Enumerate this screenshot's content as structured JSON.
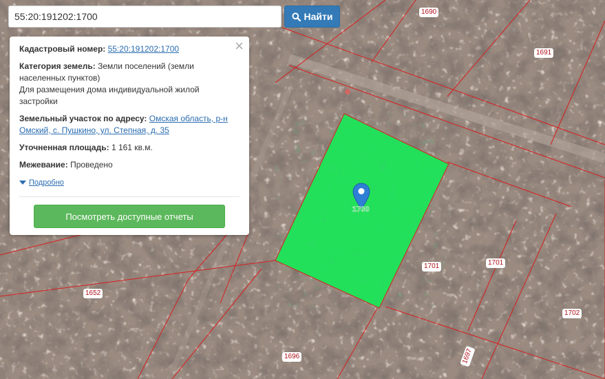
{
  "search": {
    "value": "55:20:191202:1700",
    "button_label": "Найти"
  },
  "info_panel": {
    "cadastral_label": "Кадастровый номер:",
    "cadastral_number": "55:20:191202:1700",
    "category_label": "Категория земель:",
    "category_value": "Земли поселений (земли населенных пунктов)",
    "usage": "Для размещения дома индивидуальной жилой застройки",
    "address_label": "Земельный участок по адресу:",
    "address_value": "Омская область, р-н Омский, с. Пушкино, ул. Степная, д. 35",
    "area_label": "Уточненная площадь:",
    "area_value": "1 161 кв.м.",
    "survey_label": "Межевание:",
    "survey_value": "Проведено",
    "more_link": "Подробно",
    "reports_button": "Посмотреть доступные отчеты"
  },
  "map": {
    "selected_plot_color": "#22e05a",
    "boundary_color": "#d81e1e",
    "selected_plot_label": "1700",
    "plot_labels": {
      "p1690": "1690",
      "p1691": "1691",
      "p1701a": "1701",
      "p1701b": "1701",
      "p1652": "1652",
      "p1702": "1702",
      "p1696": "1696",
      "p1697": "1697"
    }
  }
}
